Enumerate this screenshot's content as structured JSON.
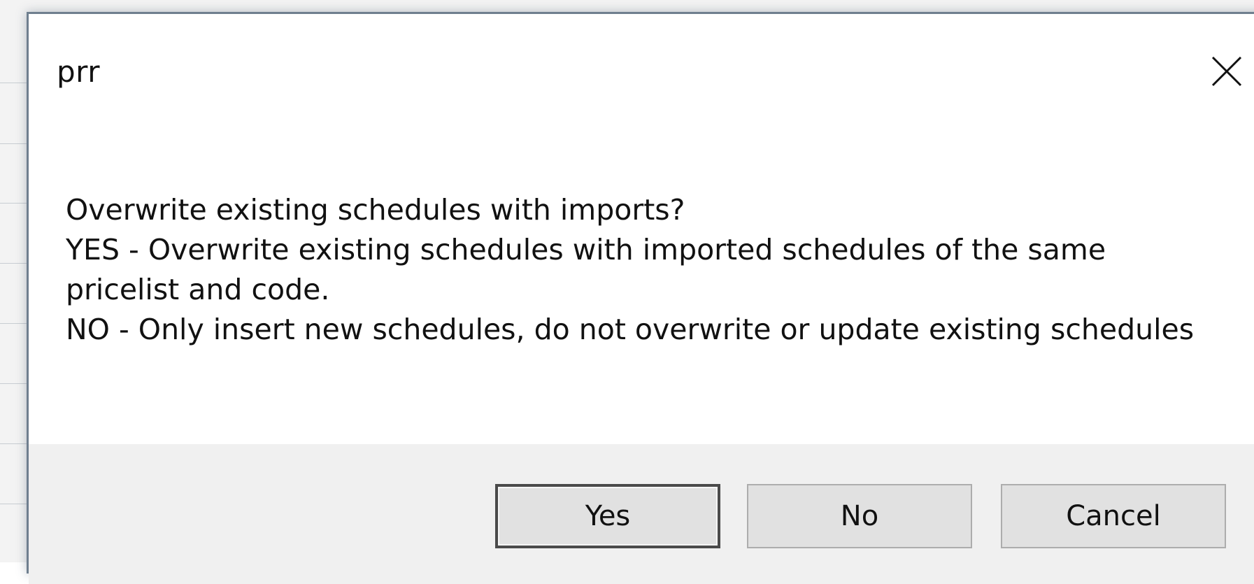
{
  "dialog": {
    "title": "prr",
    "message": "Overwrite existing schedules with imports?\nYES - Overwrite existing schedules with imported schedules of the same pricelist and code.\nNO - Only insert new schedules, do not overwrite or update existing schedules",
    "close_icon": "close-icon",
    "buttons": {
      "yes": "Yes",
      "no": "No",
      "cancel": "Cancel"
    },
    "colors": {
      "button_bar": "#f0f0f0",
      "button_face": "#e1e1e1",
      "dialog_background": "#ffffff"
    }
  }
}
